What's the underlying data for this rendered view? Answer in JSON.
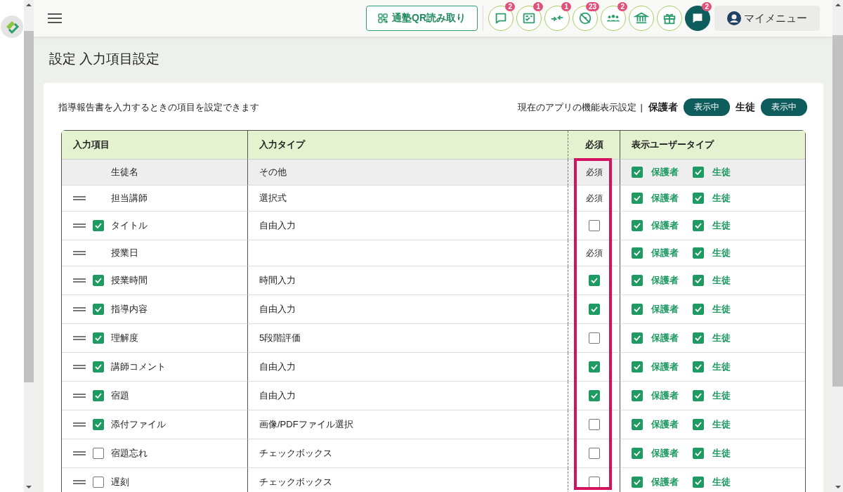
{
  "header": {
    "qr_button": "通塾QR読み取り",
    "icon_buttons": [
      {
        "kind": "chat",
        "badge": "2"
      },
      {
        "kind": "checklist",
        "badge": "1"
      },
      {
        "kind": "arrows",
        "badge": "1"
      },
      {
        "kind": "nolocation",
        "badge": "23"
      },
      {
        "kind": "people",
        "badge": "2"
      },
      {
        "kind": "bank"
      },
      {
        "kind": "gift"
      },
      {
        "kind": "chatdark",
        "badge": "2"
      }
    ],
    "my_menu": "マイメニュー"
  },
  "page_title": "設定 入力項目設定",
  "description": "指導報告書を入力するときの項目を設定できます",
  "app_display": {
    "label": "現在のアプリの機能表示設定",
    "separator": "|",
    "targets": [
      {
        "name": "保護者",
        "status": "表示中"
      },
      {
        "name": "生徒",
        "status": "表示中"
      }
    ]
  },
  "table": {
    "columns": [
      {
        "label": "入力項目",
        "highlighted": false
      },
      {
        "label": "入力タイプ",
        "highlighted": false
      },
      {
        "label": "必須",
        "highlighted": true
      },
      {
        "label": "表示ユーザータイプ",
        "highlighted": false
      }
    ],
    "rows": [
      {
        "draggable": false,
        "name": "生徒名",
        "type": "その他",
        "required": {
          "kind": "text",
          "label": "必須"
        },
        "users": [
          {
            "label": "保護者",
            "checked": true
          },
          {
            "label": "生徒",
            "checked": true
          }
        ]
      },
      {
        "draggable": true,
        "name": "担当講師",
        "type": "選択式",
        "required": {
          "kind": "text",
          "label": "必須"
        },
        "users": [
          {
            "label": "保護者",
            "checked": true
          },
          {
            "label": "生徒",
            "checked": true
          }
        ]
      },
      {
        "draggable": true,
        "enabled": true,
        "name": "タイトル",
        "type": "自由入力",
        "required": {
          "kind": "checkbox",
          "checked": false
        },
        "users": [
          {
            "label": "保護者",
            "checked": true
          },
          {
            "label": "生徒",
            "checked": true
          }
        ]
      },
      {
        "draggable": true,
        "name": "授業日",
        "required": {
          "kind": "text",
          "label": "必須"
        },
        "users": [
          {
            "label": "保護者",
            "checked": true
          },
          {
            "label": "生徒",
            "checked": true
          }
        ]
      },
      {
        "draggable": true,
        "enabled": true,
        "name": "授業時間",
        "type": "時間入力",
        "required": {
          "kind": "checkbox",
          "checked": true
        },
        "users": [
          {
            "label": "保護者",
            "checked": true
          },
          {
            "label": "生徒",
            "checked": true
          }
        ]
      },
      {
        "draggable": true,
        "enabled": true,
        "name": "指導内容",
        "type": "自由入力",
        "required": {
          "kind": "checkbox",
          "checked": true
        },
        "users": [
          {
            "label": "保護者",
            "checked": true
          },
          {
            "label": "生徒",
            "checked": true
          }
        ]
      },
      {
        "draggable": true,
        "enabled": true,
        "name": "理解度",
        "type": "5段階評価",
        "required": {
          "kind": "checkbox",
          "checked": false
        },
        "users": [
          {
            "label": "保護者",
            "checked": true
          },
          {
            "label": "生徒",
            "checked": true
          }
        ]
      },
      {
        "draggable": true,
        "enabled": true,
        "name": "講師コメント",
        "type": "自由入力",
        "required": {
          "kind": "checkbox",
          "checked": true
        },
        "users": [
          {
            "label": "保護者",
            "checked": true
          },
          {
            "label": "生徒",
            "checked": true
          }
        ]
      },
      {
        "draggable": true,
        "enabled": true,
        "name": "宿題",
        "type": "自由入力",
        "required": {
          "kind": "checkbox",
          "checked": true
        },
        "users": [
          {
            "label": "保護者",
            "checked": true
          },
          {
            "label": "生徒",
            "checked": true
          }
        ]
      },
      {
        "draggable": true,
        "enabled": true,
        "name": "添付ファイル",
        "type": "画像/PDFファイル選択",
        "required": {
          "kind": "checkbox",
          "checked": false
        },
        "users": [
          {
            "label": "保護者",
            "checked": true
          },
          {
            "label": "生徒",
            "checked": true
          }
        ]
      },
      {
        "draggable": true,
        "enabled": false,
        "name": "宿題忘れ",
        "type": "チェックボックス",
        "required": {
          "kind": "checkbox",
          "checked": false
        },
        "users": [
          {
            "label": "保護者",
            "checked": true
          },
          {
            "label": "生徒",
            "checked": true
          }
        ]
      },
      {
        "draggable": true,
        "enabled": false,
        "name": "遅刻",
        "type": "チェックボックス",
        "required": {
          "kind": "checkbox",
          "checked": false
        },
        "users": [
          {
            "label": "保護者",
            "checked": true
          },
          {
            "label": "生徒",
            "checked": true
          }
        ]
      }
    ]
  }
}
